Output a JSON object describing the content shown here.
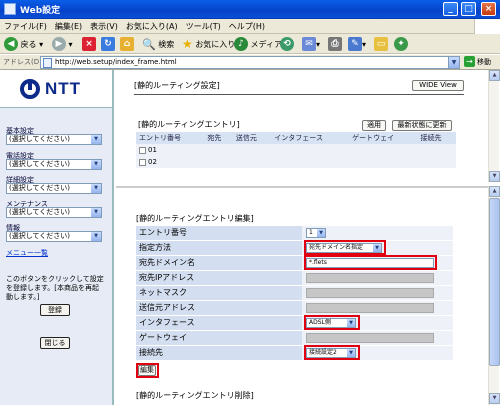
{
  "window": {
    "title": "Web設定",
    "min": "_",
    "max": "□",
    "close": "×"
  },
  "menu": [
    "ファイル(F)",
    "編集(E)",
    "表示(V)",
    "お気に入り(A)",
    "ツール(T)",
    "ヘルプ(H)"
  ],
  "toolbar": {
    "back": "戻る",
    "search": "検索",
    "favorites": "お気に入り",
    "media": "メディア"
  },
  "address": {
    "label": "アドレス(D)",
    "url": "http://web.setup/index_frame.html",
    "go": "移動"
  },
  "left": {
    "logo": "NTT",
    "sections": [
      {
        "label": "基本設定",
        "select": "(選択してください)"
      },
      {
        "label": "電話設定",
        "select": "(選択してください)"
      },
      {
        "label": "詳細設定",
        "select": "(選択してください)"
      },
      {
        "label": "メンテナンス",
        "select": "(選択してください)"
      },
      {
        "label": "情報",
        "select": "(選択してください)"
      }
    ],
    "menu_list_link": "メニュー一覧",
    "note": "このボタンをクリックして設定を登録します。[本商品を再起動します。]",
    "register_button": "登録",
    "close_button": "閉じる"
  },
  "top": {
    "title": "[静的ルーティング設定]",
    "wide_view": "WIDE View",
    "entry_title": "[静的ルーティングエントリ]",
    "apply_button": "適用",
    "refresh_button": "最新状態に更新",
    "columns": [
      "エントリ番号",
      "宛先",
      "送信元",
      "インタフェース",
      "ゲートウェイ",
      "接続先"
    ],
    "rows": [
      "01",
      "02"
    ]
  },
  "edit": {
    "title": "[静的ルーティングエントリ編集]",
    "fields": {
      "entry_no_label": "エントリ番号",
      "entry_no_value": "1",
      "method_label": "指定方法",
      "method_value": "宛先ドメイン名指定",
      "domain_label": "宛先ドメイン名",
      "domain_value": "*.flets",
      "dest_ip_label": "宛先IPアドレス",
      "netmask_label": "ネットマスク",
      "src_ip_label": "送信元アドレス",
      "iface_label": "インタフェース",
      "iface_value": "ADSL側",
      "gateway_label": "ゲートウェイ",
      "conn_label": "接続先",
      "conn_value": "接続設定2"
    },
    "edit_button": "編集",
    "delete_title": "[静的ルーティングエントリ削除]"
  }
}
